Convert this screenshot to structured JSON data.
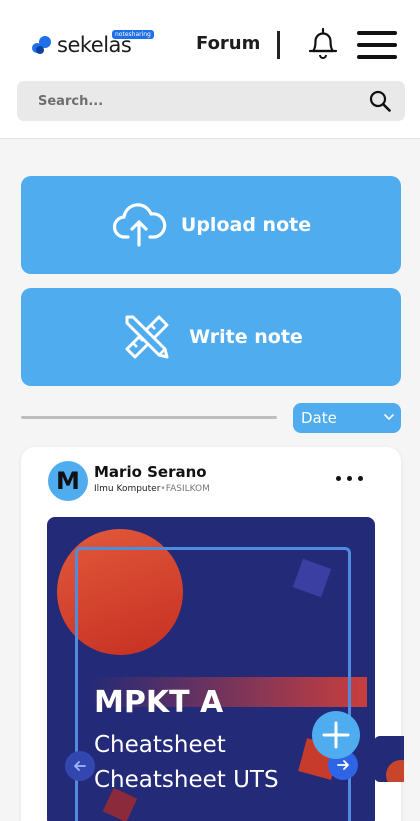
{
  "header": {
    "logo_text": "sekelas",
    "logo_badge": "notesharing",
    "forum_label": "Forum",
    "bell_icon": "bell-icon",
    "menu_icon": "hamburger-menu-icon"
  },
  "search": {
    "placeholder": "Search...",
    "icon": "search-icon"
  },
  "actions": {
    "upload_label": "Upload note",
    "write_label": "Write note"
  },
  "sort": {
    "selected": "Date"
  },
  "post": {
    "avatar_initial": "M",
    "author": "Mario Serano",
    "program": "Ilmu Komputer",
    "separator": "•",
    "faculty": "FASILKOM",
    "thumbnail": {
      "title": "MPKT A",
      "line1": "Cheatsheet",
      "line2": "Cheatsheet UTS"
    }
  },
  "colors": {
    "accent": "#4facef",
    "brand": "#1f6fe8",
    "thumb_bg": "#232a78"
  }
}
